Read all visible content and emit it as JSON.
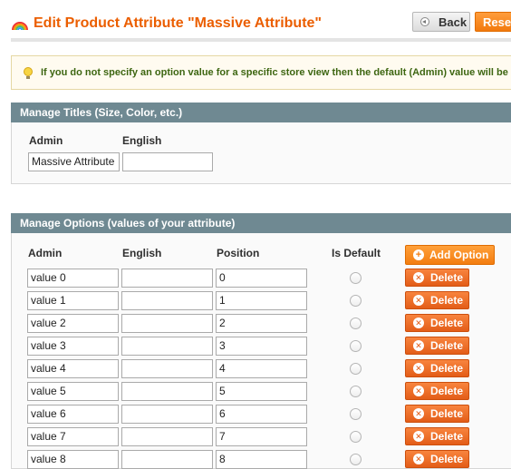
{
  "header": {
    "title": "Edit Product Attribute \"Massive Attribute\"",
    "back_label": "Back",
    "reset_label": "Reset"
  },
  "notice": {
    "text": "If you do not specify an option value for a specific store view then the default (Admin) value will be u"
  },
  "titles_section": {
    "heading": "Manage Titles (Size, Color, etc.)",
    "columns": [
      "Admin",
      "English"
    ],
    "admin_value": "Massive Attribute",
    "english_value": ""
  },
  "options_section": {
    "heading": "Manage Options (values of your attribute)",
    "columns": [
      "Admin",
      "English",
      "Position",
      "Is Default"
    ],
    "add_label": "Add Option",
    "delete_label": "Delete",
    "rows": [
      {
        "admin": "value 0",
        "english": "",
        "position": "0"
      },
      {
        "admin": "value 1",
        "english": "",
        "position": "1"
      },
      {
        "admin": "value 2",
        "english": "",
        "position": "2"
      },
      {
        "admin": "value 3",
        "english": "",
        "position": "3"
      },
      {
        "admin": "value 4",
        "english": "",
        "position": "4"
      },
      {
        "admin": "value 5",
        "english": "",
        "position": "5"
      },
      {
        "admin": "value 6",
        "english": "",
        "position": "6"
      },
      {
        "admin": "value 7",
        "english": "",
        "position": "7"
      },
      {
        "admin": "value 8",
        "english": "",
        "position": "8"
      }
    ]
  },
  "colors": {
    "title": "#eb5e00",
    "section_header": "#6f8992",
    "button_orange": "#f37d10",
    "notice_text": "#3d6611"
  }
}
